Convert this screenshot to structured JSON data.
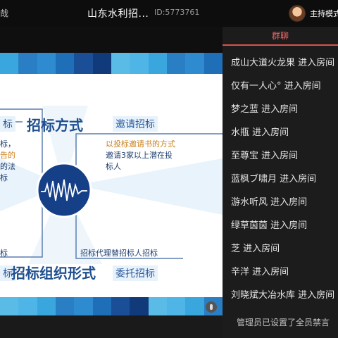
{
  "topbar": {
    "back_fragment": "哉",
    "title": "山东水利招...",
    "room_id": "ID:5773761",
    "host_mode": "主持模式"
  },
  "slide": {
    "heading_top": "招标方式",
    "heading_bottom": "招标组织形式",
    "tag_invite": "邀请招标",
    "tag_entrust": "委托招标",
    "tag_left_top": "标",
    "tag_left_bottom": "标",
    "invite_desc_lines": [
      "以投标邀请书的方式",
      "邀请3家以上潜在投",
      "标人"
    ],
    "left_desc_lines": [
      "标，",
      "告的",
      "的法",
      "标"
    ],
    "agency_desc": "招标代理替招标人招标",
    "left_bottom_fragment": "标",
    "stripe_colors": [
      "#3aa6de",
      "#1f6fb8",
      "#5bbbe7",
      "#2a7fc4",
      "#1a4f98",
      "#4fb5e6",
      "#2f8bd0",
      "#103a7a"
    ]
  },
  "chat": {
    "tab_label": "群聊",
    "messages": [
      "成山大道火龙果 进入房间",
      "仅有一人心° 进入房间",
      "梦之蓝 进入房间",
      "水瓶 进入房间",
      "至尊宝 进入房间",
      "蓝枫ブ啸月 进入房间",
      "游水听风 进入房间",
      "绿草茵茵 进入房间",
      "芝 进入房间",
      "辛洋 进入房间",
      "刘晓斌大冶水库 进入房间"
    ],
    "notice": "管理员已设置了全员禁言"
  }
}
